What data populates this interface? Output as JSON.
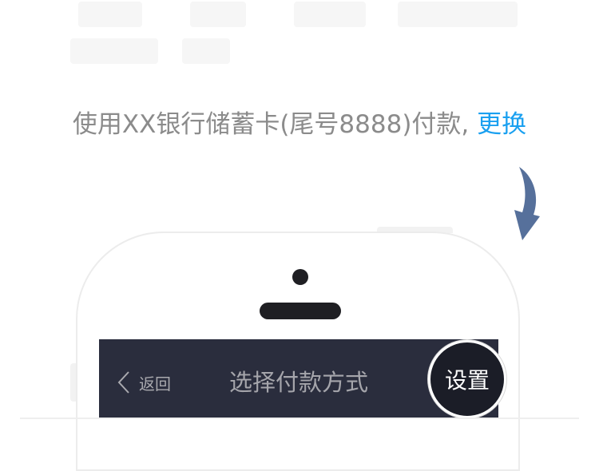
{
  "payment": {
    "prompt_text": "使用XX银行储蓄卡(尾号8888)付款,",
    "change_link": "更换"
  },
  "navbar": {
    "back_label": "返回",
    "title": "选择付款方式",
    "settings_label": "设置"
  },
  "icons": {
    "pointer": "curved-arrow-down-icon",
    "back": "chevron-left-icon"
  },
  "colors": {
    "link": "#1aa0f0",
    "arrow": "#56709b",
    "navbar_bg": "#2a2d3d",
    "text_muted": "#8b8b8b"
  }
}
